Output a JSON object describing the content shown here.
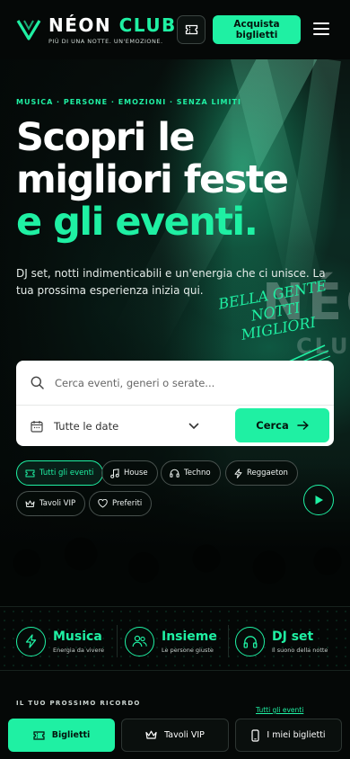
{
  "brand": {
    "name_main": "NÉON",
    "name_accent": "CLUB",
    "tagline": "PIÙ DI UNA NOTTE. UN'EMOZIONE."
  },
  "header": {
    "buy_label": "Acquista biglietti"
  },
  "hero": {
    "eyebrow": "MUSICA · PERSONE · EMOZIONI · SENZA LIMITI",
    "title_line1": "Scopri le",
    "title_line2": "migliori feste",
    "title_line3": "e gli eventi",
    "title_dot": ".",
    "subtitle": "DJ set, notti indimenticabili e un'energia che ci unisce. La tua prossima esperienza inizia qui.",
    "handwritten": [
      "BELLA GENTE",
      "NOTTI",
      "MIGLIORI"
    ],
    "sign_text": "NÉON",
    "sign_sub": "CLUB"
  },
  "search": {
    "placeholder": "Cerca eventi, generi o serate...",
    "date_value": "Tutte le date",
    "button_label": "Cerca"
  },
  "chips": [
    {
      "label": "Tutti gli eventi",
      "icon": "ticket-icon",
      "active": true
    },
    {
      "label": "House",
      "icon": "music-note-icon",
      "active": false
    },
    {
      "label": "Techno",
      "icon": "headphones-icon",
      "active": false
    },
    {
      "label": "Reggaeton",
      "icon": "lightning-icon",
      "active": false
    },
    {
      "label": "Tavoli VIP",
      "icon": "crown-icon",
      "active": false
    },
    {
      "label": "Preferiti",
      "icon": "heart-icon",
      "active": false
    }
  ],
  "features": [
    {
      "title": "Musica",
      "subtitle": "Energia da vivere",
      "icon": "lightning-icon"
    },
    {
      "title": "Insieme",
      "subtitle": "Le persone giuste",
      "icon": "people-icon"
    },
    {
      "title": "DJ set",
      "subtitle": "Il suono della notte",
      "icon": "headphones-icon"
    }
  ],
  "section": {
    "label": "IL TUO PROSSIMO RICORDO",
    "link": "Tutti gli eventi"
  },
  "bottom_nav": [
    {
      "label": "Biglietti",
      "icon": "ticket-icon",
      "primary": true
    },
    {
      "label": "Tavoli VIP",
      "icon": "crown-icon",
      "primary": false
    },
    {
      "label": "I miei biglietti",
      "icon": "mobile-ticket-icon",
      "primary": false
    }
  ],
  "colors": {
    "accent": "#1ff0a3",
    "background": "#050807",
    "search_card": "#ffffff"
  }
}
